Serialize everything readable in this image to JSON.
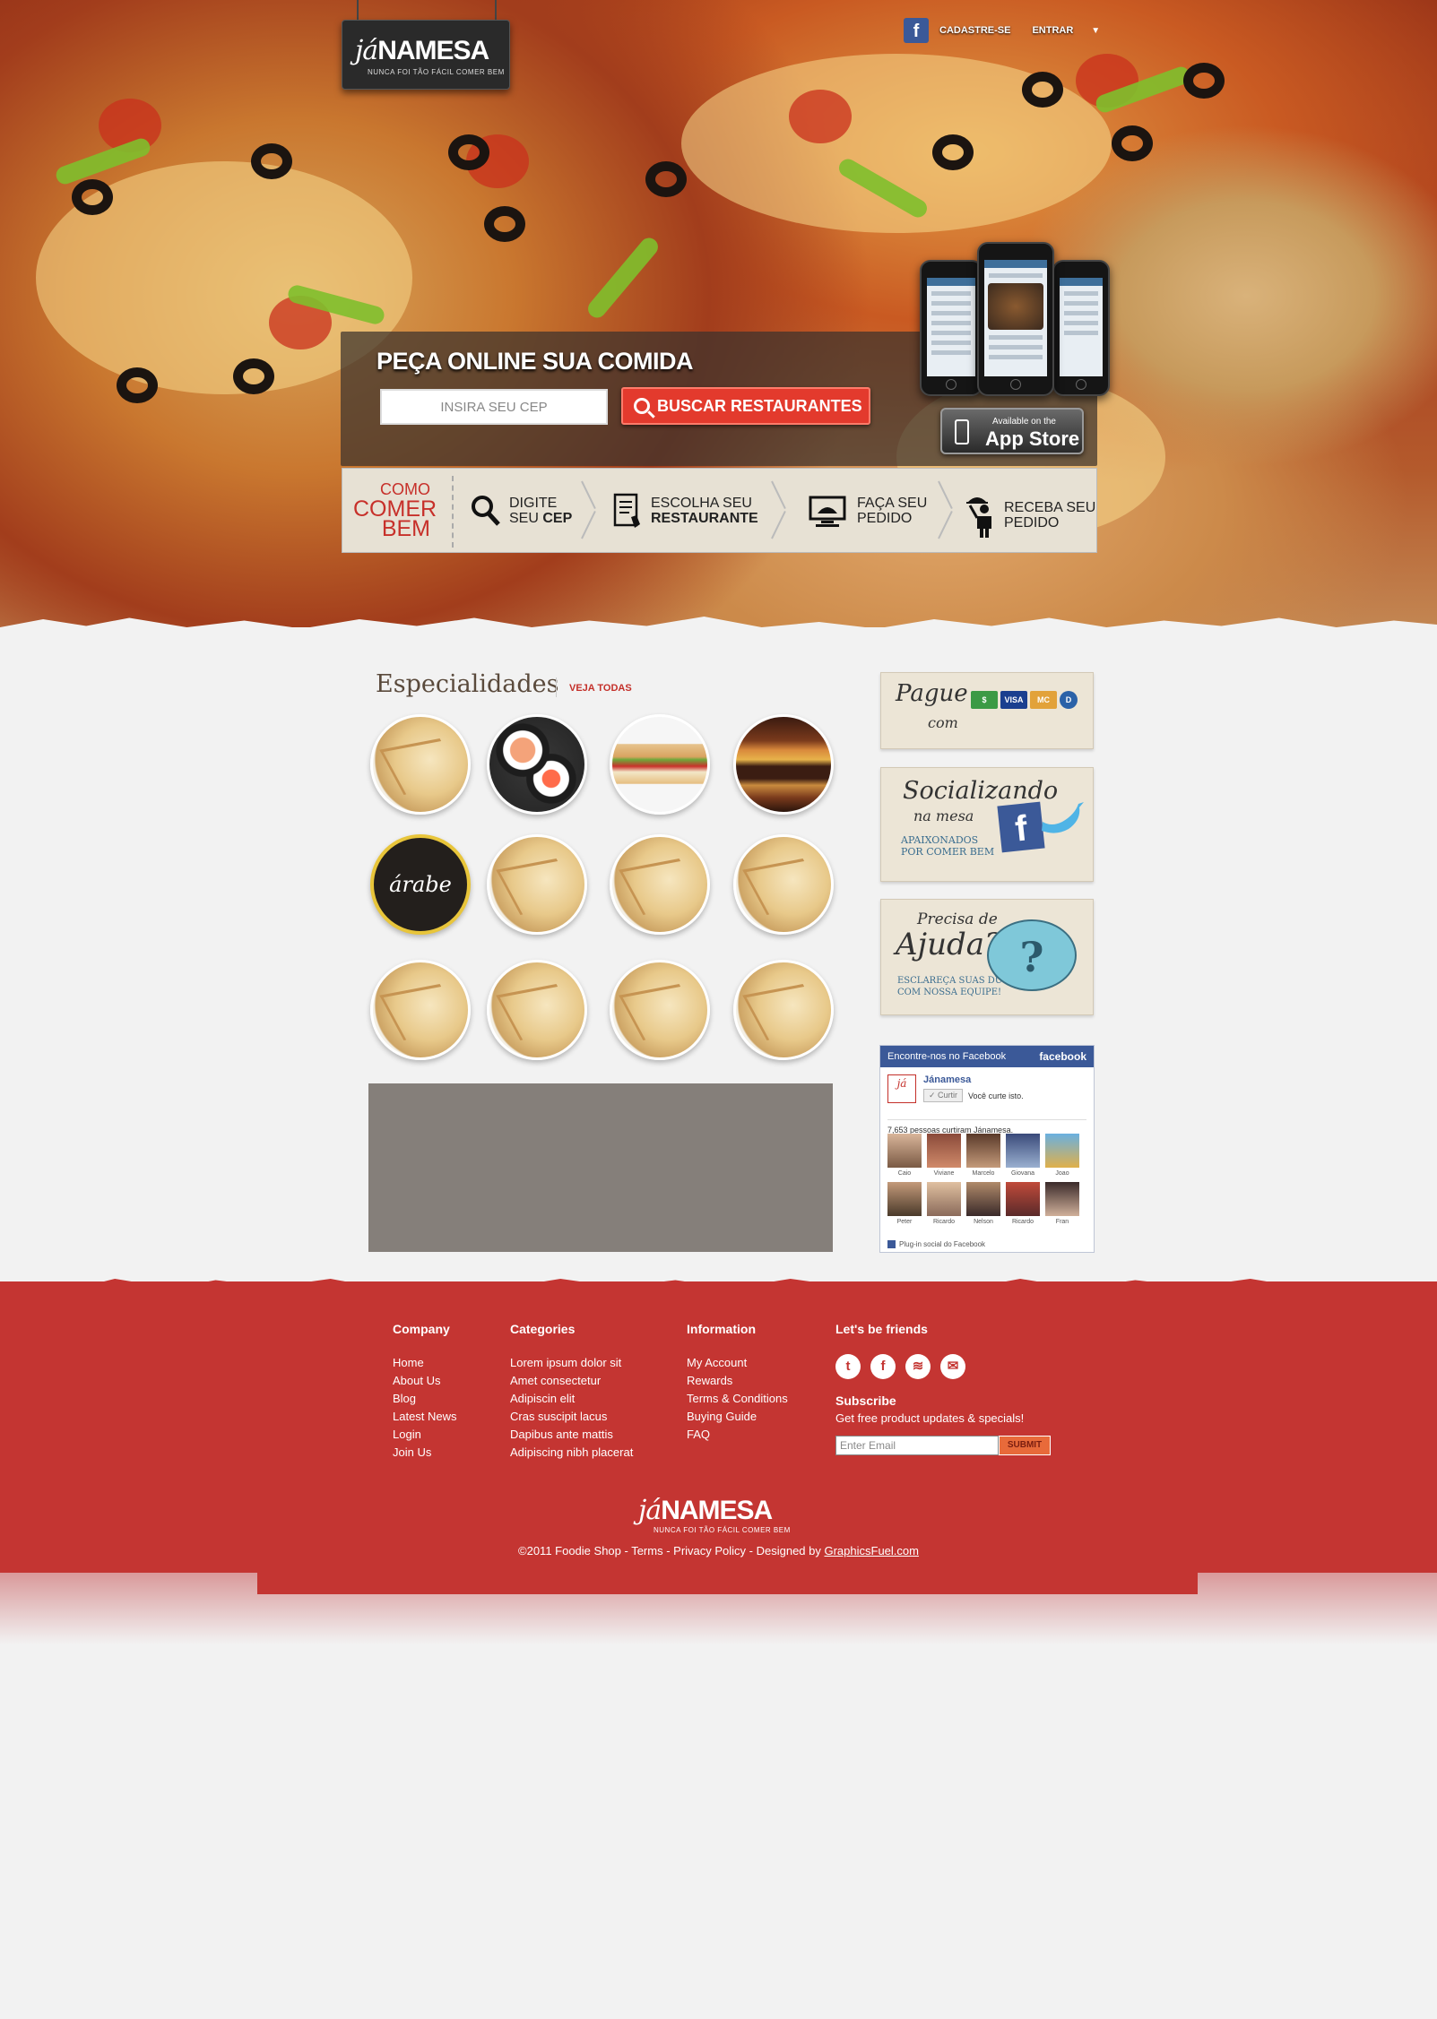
{
  "brand": {
    "logo_prefix": "já",
    "logo_main": "NAMESA",
    "tagline": "NUNCA FOI TÃO FÁCIL COMER BEM"
  },
  "nav": {
    "facebook_icon": "f",
    "signup": "CADASTRE-SE",
    "login": "ENTRAR",
    "caret": "▼"
  },
  "hero": {
    "title": "PEÇA ONLINE SUA COMIDA",
    "cep_placeholder": "INSIRA SEU CEP",
    "search_button": "BUSCAR RESTAURANTES",
    "appstore_small": "Available on the",
    "appstore_big": "App Store"
  },
  "how": {
    "title_l1": "COMO",
    "title_l2": "COMER",
    "title_l3": "BEM",
    "steps": [
      {
        "l1": "DIGITE",
        "l2a": "SEU ",
        "l2b": "CEP"
      },
      {
        "l1": "ESCOLHA SEU",
        "l2a": "",
        "l2b": "RESTAURANTE"
      },
      {
        "l1": "FAÇA SEU",
        "l2a": "PEDIDO",
        "l2b": ""
      },
      {
        "l1": "RECEBA SEU",
        "l2a": "PEDIDO",
        "l2b": ""
      }
    ]
  },
  "specialties": {
    "title": "Especialidades",
    "see_all": "VEJA TODAS",
    "arabe_label": "árabe"
  },
  "sidebar": {
    "pay_title": "Pague",
    "pay_sub": "com",
    "pay_cash": "$",
    "pay_visa": "VISA",
    "pay_mc": "MC",
    "pay_dc": "D",
    "social_title": "Socializando",
    "social_sub": "na mesa",
    "social_desc_l1": "APAIXONADOS",
    "social_desc_l2": "POR COMER BEM",
    "help_pre": "Precisa de",
    "help_title": "Ajuda?",
    "help_desc_l1": "ESCLAREÇA SUAS DÚVIDAS",
    "help_desc_l2": "COM NOSSA EQUIPE!",
    "help_mark": "?"
  },
  "facebook": {
    "header": "Encontre-nos no Facebook",
    "header_brand": "facebook",
    "page_name": "Jánamesa",
    "like_btn": "✓ Curtir",
    "like_text": "Você curte isto.",
    "count": "7,653 pessoas curtiram Jánamesa.",
    "faces": [
      "Caio",
      "Viviane",
      "Marcelo",
      "Giovana",
      "Joao",
      "Peter",
      "Ricardo",
      "Nelson",
      "Ricardo",
      "Fran"
    ],
    "footer": "Plug-in social do Facebook"
  },
  "footer": {
    "company": {
      "title": "Company",
      "links": [
        "Home",
        "About Us",
        "Blog",
        "Latest News",
        "Login",
        "Join Us"
      ]
    },
    "categories": {
      "title": "Categories",
      "links": [
        "Lorem ipsum dolor sit",
        "Amet consectetur",
        "Adipiscin elit",
        "Cras suscipit lacus",
        "Dapibus ante mattis",
        "Adipiscing nibh placerat"
      ]
    },
    "information": {
      "title": "Information",
      "links": [
        "My Account",
        "Rewards",
        "Terms & Conditions",
        "Buying Guide",
        "FAQ"
      ]
    },
    "friends_title": "Let's be friends",
    "social_icons": [
      "t",
      "f",
      "≋",
      "✉"
    ],
    "subscribe_title": "Subscribe",
    "subscribe_text": "Get free product updates & specials!",
    "email_placeholder": "Enter Email",
    "submit": "SUBMIT",
    "copyright": "©2011 Foodie Shop - Terms - Privacy Policy - Designed by ",
    "designer": "GraphicsFuel.com"
  },
  "colors": {
    "brand_red": "#c43532",
    "button_red": "#e33a2d",
    "facebook_blue": "#3b5998"
  }
}
